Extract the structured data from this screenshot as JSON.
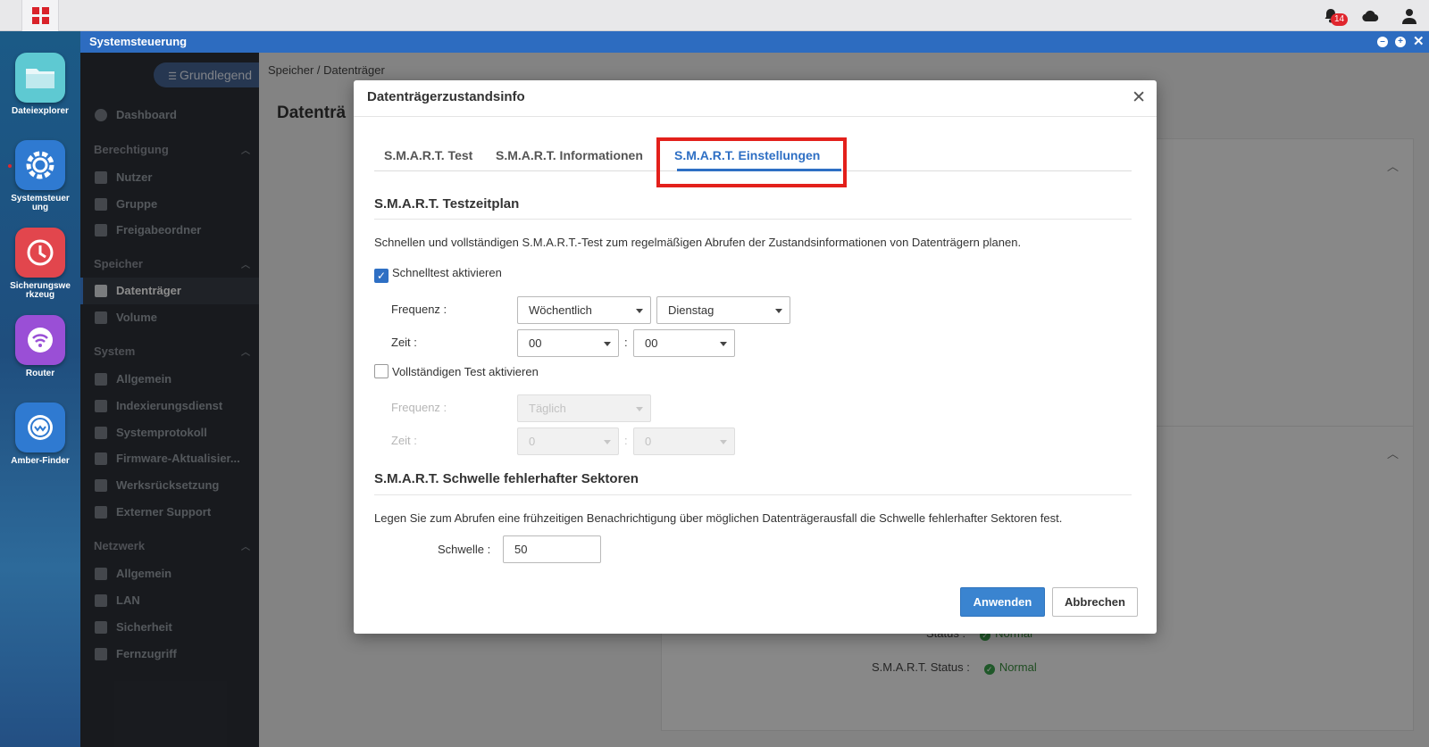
{
  "topbar": {
    "notification_count": "14"
  },
  "dock": {
    "items": [
      {
        "label": "Dateiexplorer",
        "icon": "folder-icon",
        "color": "#5ec9d2"
      },
      {
        "label": "Systemsteuerung",
        "icon": "gear-icon",
        "color": "#2f7ad1"
      },
      {
        "label": "Sicherungswerkzeug",
        "icon": "backup-clock-icon",
        "color": "#e2464d"
      },
      {
        "label": "Router",
        "icon": "wifi-icon",
        "color": "#9a4fd6"
      },
      {
        "label": "Amber-Finder",
        "icon": "finder-icon",
        "color": "#2f7ad1"
      }
    ]
  },
  "window": {
    "title": "Systemsteuerung"
  },
  "sidebar": {
    "mode_button": "Grundlegend",
    "dashboard": "Dashboard",
    "sections": [
      {
        "title": "Berechtigung",
        "items": [
          "Nutzer",
          "Gruppe",
          "Freigabeordner"
        ]
      },
      {
        "title": "Speicher",
        "items": [
          "Datenträger",
          "Volume"
        ]
      },
      {
        "title": "System",
        "items": [
          "Allgemein",
          "Indexierungsdienst",
          "Systemprotokoll",
          "Firmware-Aktualisier...",
          "Werksrücksetzung",
          "Externer Support"
        ]
      },
      {
        "title": "Netzwerk",
        "items": [
          "Allgemein",
          "LAN",
          "Sicherheit",
          "Fernzugriff"
        ]
      }
    ],
    "active_item": "Datenträger"
  },
  "main": {
    "breadcrumb": "Speicher / Datenträger",
    "page_title": "Datenträ",
    "status_label": "Status :",
    "status_value": "Normal",
    "smart_status_label": "S.M.A.R.T. Status :",
    "smart_status_value": "Normal"
  },
  "dialog": {
    "title": "Datenträgerzustandsinfo",
    "tabs": [
      "S.M.A.R.T. Test",
      "S.M.A.R.T. Informationen",
      "S.M.A.R.T. Einstellungen"
    ],
    "active_tab": "S.M.A.R.T. Einstellungen",
    "schedule": {
      "title": "S.M.A.R.T. Testzeitplan",
      "description": "Schnellen und vollständigen S.M.A.R.T.-Test zum regelmäßigen Abrufen der Zustandsinformationen von Datenträgern planen.",
      "quick_test": {
        "label": "Schnelltest aktivieren",
        "checked": true,
        "frequency_label": "Frequenz :",
        "frequency_value": "Wöchentlich",
        "day_value": "Dienstag",
        "time_label": "Zeit :",
        "hour_value": "00",
        "minute_value": "00",
        "separator": ":"
      },
      "full_test": {
        "label": "Vollständigen Test aktivieren",
        "checked": false,
        "frequency_label": "Frequenz :",
        "frequency_value": "Täglich",
        "time_label": "Zeit :",
        "hour_value": "0",
        "minute_value": "0",
        "separator": ":"
      }
    },
    "threshold": {
      "title": "S.M.A.R.T. Schwelle fehlerhafter Sektoren",
      "description": "Legen Sie zum Abrufen eine frühzeitigen Benachrichtigung über möglichen Datenträgerausfall die Schwelle fehlerhafter Sektoren fest.",
      "label": "Schwelle :",
      "value": "50"
    },
    "buttons": {
      "apply": "Anwenden",
      "cancel": "Abbrechen"
    }
  },
  "colors": {
    "accent": "#2e6fc4",
    "highlight": "#e3201b",
    "sidebar_bg": "#2d3138",
    "titlebar": "#2d6cc0"
  }
}
